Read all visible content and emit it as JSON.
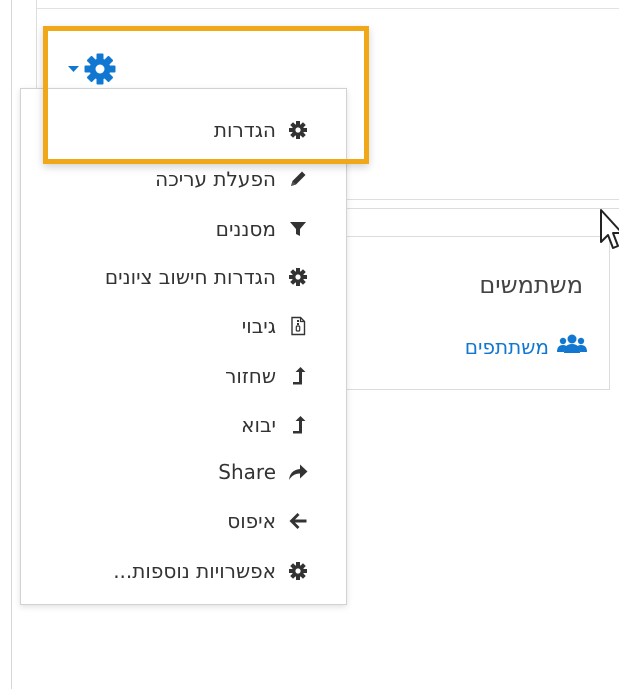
{
  "colors": {
    "accent": "#1177d1",
    "highlight": "#f0a818",
    "icon": "#333333"
  },
  "trigger": {
    "icon": "gear-icon",
    "caret": "caret-down-icon"
  },
  "menu": {
    "items": [
      {
        "label": "הגדרות",
        "icon": "gear-icon"
      },
      {
        "label": "הפעלת עריכה",
        "icon": "pencil-icon"
      },
      {
        "label": "מסננים",
        "icon": "filter-icon"
      },
      {
        "label": "הגדרות חישוב ציונים",
        "icon": "gear-icon"
      },
      {
        "label": "גיבוי",
        "icon": "file-archive-icon"
      },
      {
        "label": "שחזור",
        "icon": "level-up-icon"
      },
      {
        "label": "יבוא",
        "icon": "level-up-icon"
      },
      {
        "label": "Share",
        "icon": "share-icon"
      },
      {
        "label": "איפוס",
        "icon": "arrow-left-icon"
      },
      {
        "label": "אפשרויות נוספות...",
        "icon": "gear-icon"
      }
    ]
  },
  "block": {
    "title": "משתמשים",
    "link": {
      "label": "משתתפים",
      "icon": "users-icon"
    }
  }
}
